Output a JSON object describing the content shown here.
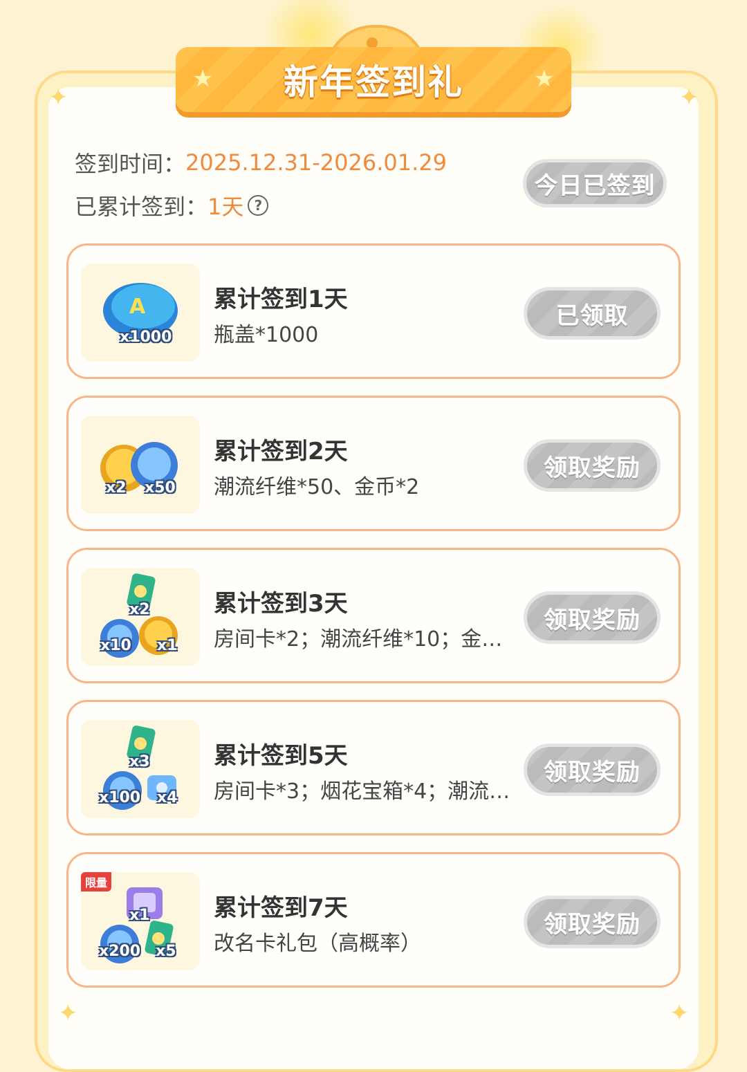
{
  "banner": {
    "title": "新年签到礼"
  },
  "info": {
    "time_label": "签到时间：",
    "time_value": "2025.12.31-2026.01.29",
    "count_label": "已累计签到：",
    "count_value": "1天",
    "help_glyph": "?"
  },
  "status_button": {
    "label": "今日已签到"
  },
  "rewards": [
    {
      "title": "累计签到1天",
      "desc": "瓶盖*1000",
      "button": "已领取",
      "quantities": [
        "x1000"
      ]
    },
    {
      "title": "累计签到2天",
      "desc": "潮流纤维*50、金币*2",
      "button": "领取奖励",
      "quantities": [
        "x2",
        "x50"
      ]
    },
    {
      "title": "累计签到3天",
      "desc": "房间卡*2；潮流纤维*10；金…",
      "button": "领取奖励",
      "quantities": [
        "x2",
        "x10",
        "x1"
      ]
    },
    {
      "title": "累计签到5天",
      "desc": "房间卡*3；烟花宝箱*4；潮流…",
      "button": "领取奖励",
      "quantities": [
        "x3",
        "x100",
        "x4"
      ]
    },
    {
      "title": "累计签到7天",
      "desc": "改名卡礼包（高概率）",
      "button": "领取奖励",
      "quantities": [
        "x1",
        "x200",
        "x5"
      ],
      "badge": "限量"
    }
  ],
  "icons": [
    "star-icon",
    "help-icon",
    "bottle-cap-icon",
    "gold-coin-icon",
    "fiber-icon",
    "room-card-icon",
    "gift-box-icon",
    "rename-card-icon"
  ]
}
